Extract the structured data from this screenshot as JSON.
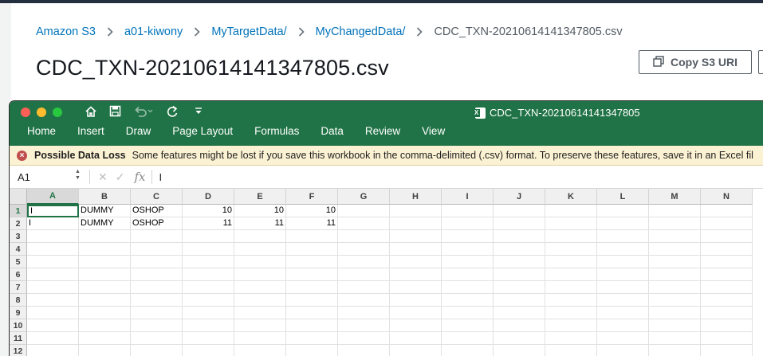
{
  "breadcrumb": {
    "items": [
      "Amazon S3",
      "a01-kiwony",
      "MyTargetData/",
      "MyChangedData/"
    ],
    "current": "CDC_TXN-20210614141347805.csv"
  },
  "page_title": "CDC_TXN-20210614141347805.csv",
  "copy_button": {
    "label": "Copy S3 URI",
    "icon": "copy-icon"
  },
  "excel": {
    "window_title": "CDC_TXN-20210614141347805",
    "quick_access": [
      "home-icon",
      "save-icon",
      "undo-icon",
      "redo-icon",
      "customize-icon"
    ],
    "ribbon_tabs": [
      "Home",
      "Insert",
      "Draw",
      "Page Layout",
      "Formulas",
      "Data",
      "Review",
      "View"
    ],
    "warning": {
      "title": "Possible Data Loss",
      "message": "Some features might be lost if you save this workbook in the comma-delimited (.csv) format. To preserve these features, save it in an Excel fil"
    },
    "formula_bar": {
      "name_box": "A1",
      "fx": "fx",
      "value": "I"
    },
    "columns": [
      "A",
      "B",
      "C",
      "D",
      "E",
      "F",
      "G",
      "H",
      "I",
      "J",
      "K",
      "L",
      "M",
      "N"
    ],
    "row_numbers": [
      "1",
      "2",
      "3",
      "4",
      "5",
      "6",
      "7",
      "8",
      "9",
      "10",
      "11",
      "12"
    ],
    "rows": [
      [
        "I",
        "DUMMY",
        "OSHOP",
        "10",
        "10",
        "10"
      ],
      [
        "I",
        "DUMMY",
        "OSHOP",
        "11",
        "11",
        "11"
      ]
    ]
  },
  "colors": {
    "excel_green": "#207346",
    "aws_link": "#0073bb",
    "warning_bg": "#fbf1d3"
  }
}
